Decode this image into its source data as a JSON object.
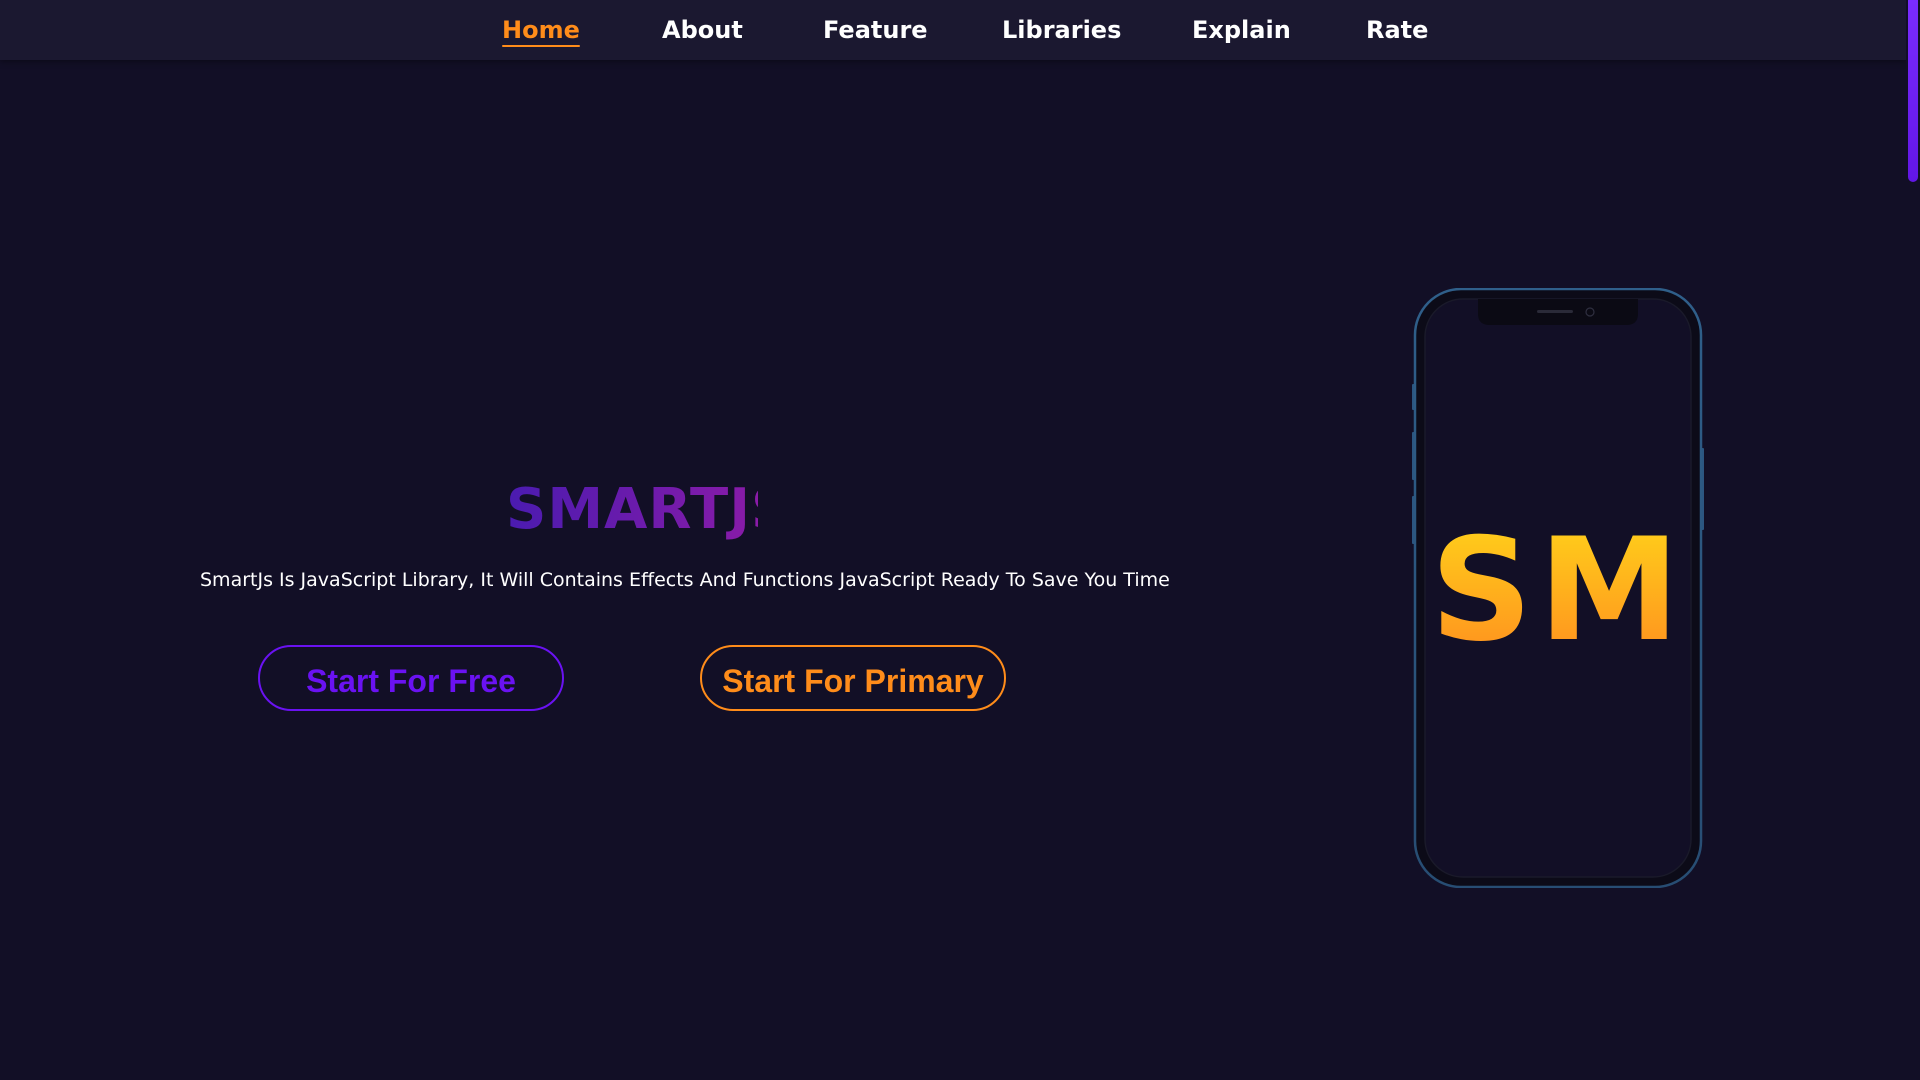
{
  "nav": {
    "items": [
      {
        "label": "Home",
        "active": true
      },
      {
        "label": "About",
        "active": false
      },
      {
        "label": "Feature",
        "active": false
      },
      {
        "label": "Libraries",
        "active": false
      },
      {
        "label": "Explain",
        "active": false
      },
      {
        "label": "Rate",
        "active": false
      }
    ]
  },
  "hero": {
    "title": "SMARTJS",
    "description": "SmartJs Is JavaScript Library, It Will Contains Effects And Functions JavaScript Ready To Save You Time",
    "buttons": {
      "free_label": "Start For Free",
      "primary_label": "Start For Primary"
    }
  },
  "phone": {
    "logo_text": "SM"
  },
  "colors": {
    "background": "#120f26",
    "nav_background": "#1b1830",
    "accent_orange": "#ff8c1a",
    "accent_purple": "#6a12f2",
    "text": "#ffffff"
  },
  "icons": {
    "phone": "smartphone-mockup-icon"
  }
}
